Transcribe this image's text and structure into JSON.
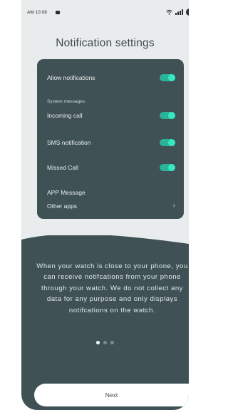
{
  "status_bar": {
    "time": "AM 10:08",
    "icons": [
      "sim-icon",
      "wifi-icon",
      "signal-icon",
      "battery-icon"
    ]
  },
  "title": "Notification settings",
  "settings": {
    "allow_notifications": {
      "label": "Allow notifications",
      "on": true
    },
    "system_messages_label": "System messages",
    "incoming_call": {
      "label": "Incoming call",
      "on": true
    },
    "sms_notification": {
      "label": "SMS notification",
      "on": true
    },
    "missed_call": {
      "label": "Missed Call",
      "on": true
    },
    "app_message_label": "APP Message",
    "other_apps": {
      "label": "Other apps",
      "icon": "chevron-right-icon"
    }
  },
  "description": "When your watch is close to your phone, you can receive notifcations from your phone through your watch. We do not collect any data for any purpose and only displays notifcations on the watch.",
  "pagination": {
    "total": 3,
    "current": 1
  },
  "next_label": "Next",
  "colors": {
    "card_bg": "#3f5154",
    "toggle_track": "#2bb39a",
    "toggle_knob": "#37e6c3",
    "page_bg": "#e9ecec"
  }
}
